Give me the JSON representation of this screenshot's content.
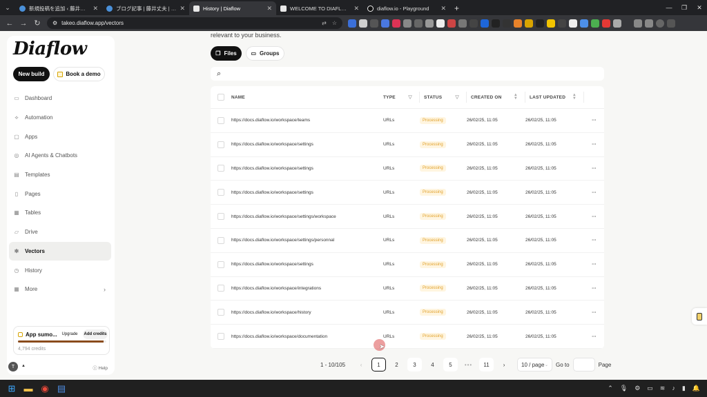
{
  "browser": {
    "tabs": [
      {
        "title": "新規投稿を追加 ‹ 藤井丈夫 | 起",
        "active": false
      },
      {
        "title": "ブログ記事 | 藤井丈夫 | 起業家・",
        "active": false
      },
      {
        "title": "History | Diaflow",
        "active": true
      },
      {
        "title": "WELCOME TO DIAFLOW | Diaf",
        "active": false
      },
      {
        "title": "diaflow.io - Playground",
        "active": false
      }
    ],
    "url": "takeo.diaflow.app/vectors",
    "close_glyph": "✕",
    "new_tab_glyph": "+"
  },
  "sidebar": {
    "logo": "Diaflow",
    "new_build": "New build",
    "book_demo": "Book a demo",
    "items": [
      {
        "label": "Dashboard",
        "icon": "▭"
      },
      {
        "label": "Automation",
        "icon": "⟡"
      },
      {
        "label": "Apps",
        "icon": "▢"
      },
      {
        "label": "AI Agents & Chatbots",
        "icon": "◎"
      },
      {
        "label": "Templates",
        "icon": "▤"
      },
      {
        "label": "Pages",
        "icon": "▯"
      },
      {
        "label": "Tables",
        "icon": "▦"
      },
      {
        "label": "Drive",
        "icon": "▱"
      },
      {
        "label": "Vectors",
        "icon": "✱"
      },
      {
        "label": "History",
        "icon": "◷"
      },
      {
        "label": "More",
        "icon": "▦"
      }
    ],
    "plan": {
      "name": "App sumo...",
      "upgrade": "Upgrade",
      "add_credits": "Add credits",
      "credits": "4,794 credits",
      "usage_fraction": 0.97
    },
    "user_initial": "T",
    "help": "Help"
  },
  "main": {
    "subtitle": "relevant to your business.",
    "tab_files": "Files",
    "tab_groups": "Groups",
    "search_placeholder": "",
    "columns": {
      "name": "NAME",
      "type": "TYPE",
      "status": "STATUS",
      "created": "CREATED ON",
      "updated": "LAST UPDATED"
    },
    "rows": [
      {
        "name": "https://docs.diaflow.io/workspace/teams",
        "type": "URLs",
        "status": "Processing",
        "created": "26/02/25, 11:05",
        "updated": "26/02/25, 11:05"
      },
      {
        "name": "https://docs.diaflow.io/workspace/settings",
        "type": "URLs",
        "status": "Processing",
        "created": "26/02/25, 11:05",
        "updated": "26/02/25, 11:05"
      },
      {
        "name": "https://docs.diaflow.io/workspace/settings",
        "type": "URLs",
        "status": "Processing",
        "created": "26/02/25, 11:05",
        "updated": "26/02/25, 11:05"
      },
      {
        "name": "https://docs.diaflow.io/workspace/settings",
        "type": "URLs",
        "status": "Processing",
        "created": "26/02/25, 11:05",
        "updated": "26/02/25, 11:05"
      },
      {
        "name": "https://docs.diaflow.io/workspace/settings/workspace",
        "type": "URLs",
        "status": "Processing",
        "created": "26/02/25, 11:05",
        "updated": "26/02/25, 11:05"
      },
      {
        "name": "https://docs.diaflow.io/workspace/settings/personnal",
        "type": "URLs",
        "status": "Processing",
        "created": "26/02/25, 11:05",
        "updated": "26/02/25, 11:05"
      },
      {
        "name": "https://docs.diaflow.io/workspace/settings",
        "type": "URLs",
        "status": "Processing",
        "created": "26/02/25, 11:05",
        "updated": "26/02/25, 11:05"
      },
      {
        "name": "https://docs.diaflow.io/workspace/integrations",
        "type": "URLs",
        "status": "Processing",
        "created": "26/02/25, 11:05",
        "updated": "26/02/25, 11:05"
      },
      {
        "name": "https://docs.diaflow.io/workspace/history",
        "type": "URLs",
        "status": "Processing",
        "created": "26/02/25, 11:05",
        "updated": "26/02/25, 11:05"
      },
      {
        "name": "https://docs.diaflow.io/workspace/documentation",
        "type": "URLs",
        "status": "Processing",
        "created": "26/02/25, 11:05",
        "updated": "26/02/25, 11:05"
      }
    ],
    "row_menu": "···"
  },
  "pagination": {
    "total": "1 - 10/105",
    "prev": "‹",
    "next": "›",
    "pages": [
      "1",
      "2",
      "3",
      "4",
      "5"
    ],
    "dots": "•••",
    "last": "11",
    "current": "1",
    "page_size": "10 / page",
    "goto_label": "Go to",
    "page_label": "Page"
  },
  "colors": {
    "accent": "#111111",
    "status_processing": "#e0a12b",
    "credit_bar": "#8a4b1c"
  }
}
